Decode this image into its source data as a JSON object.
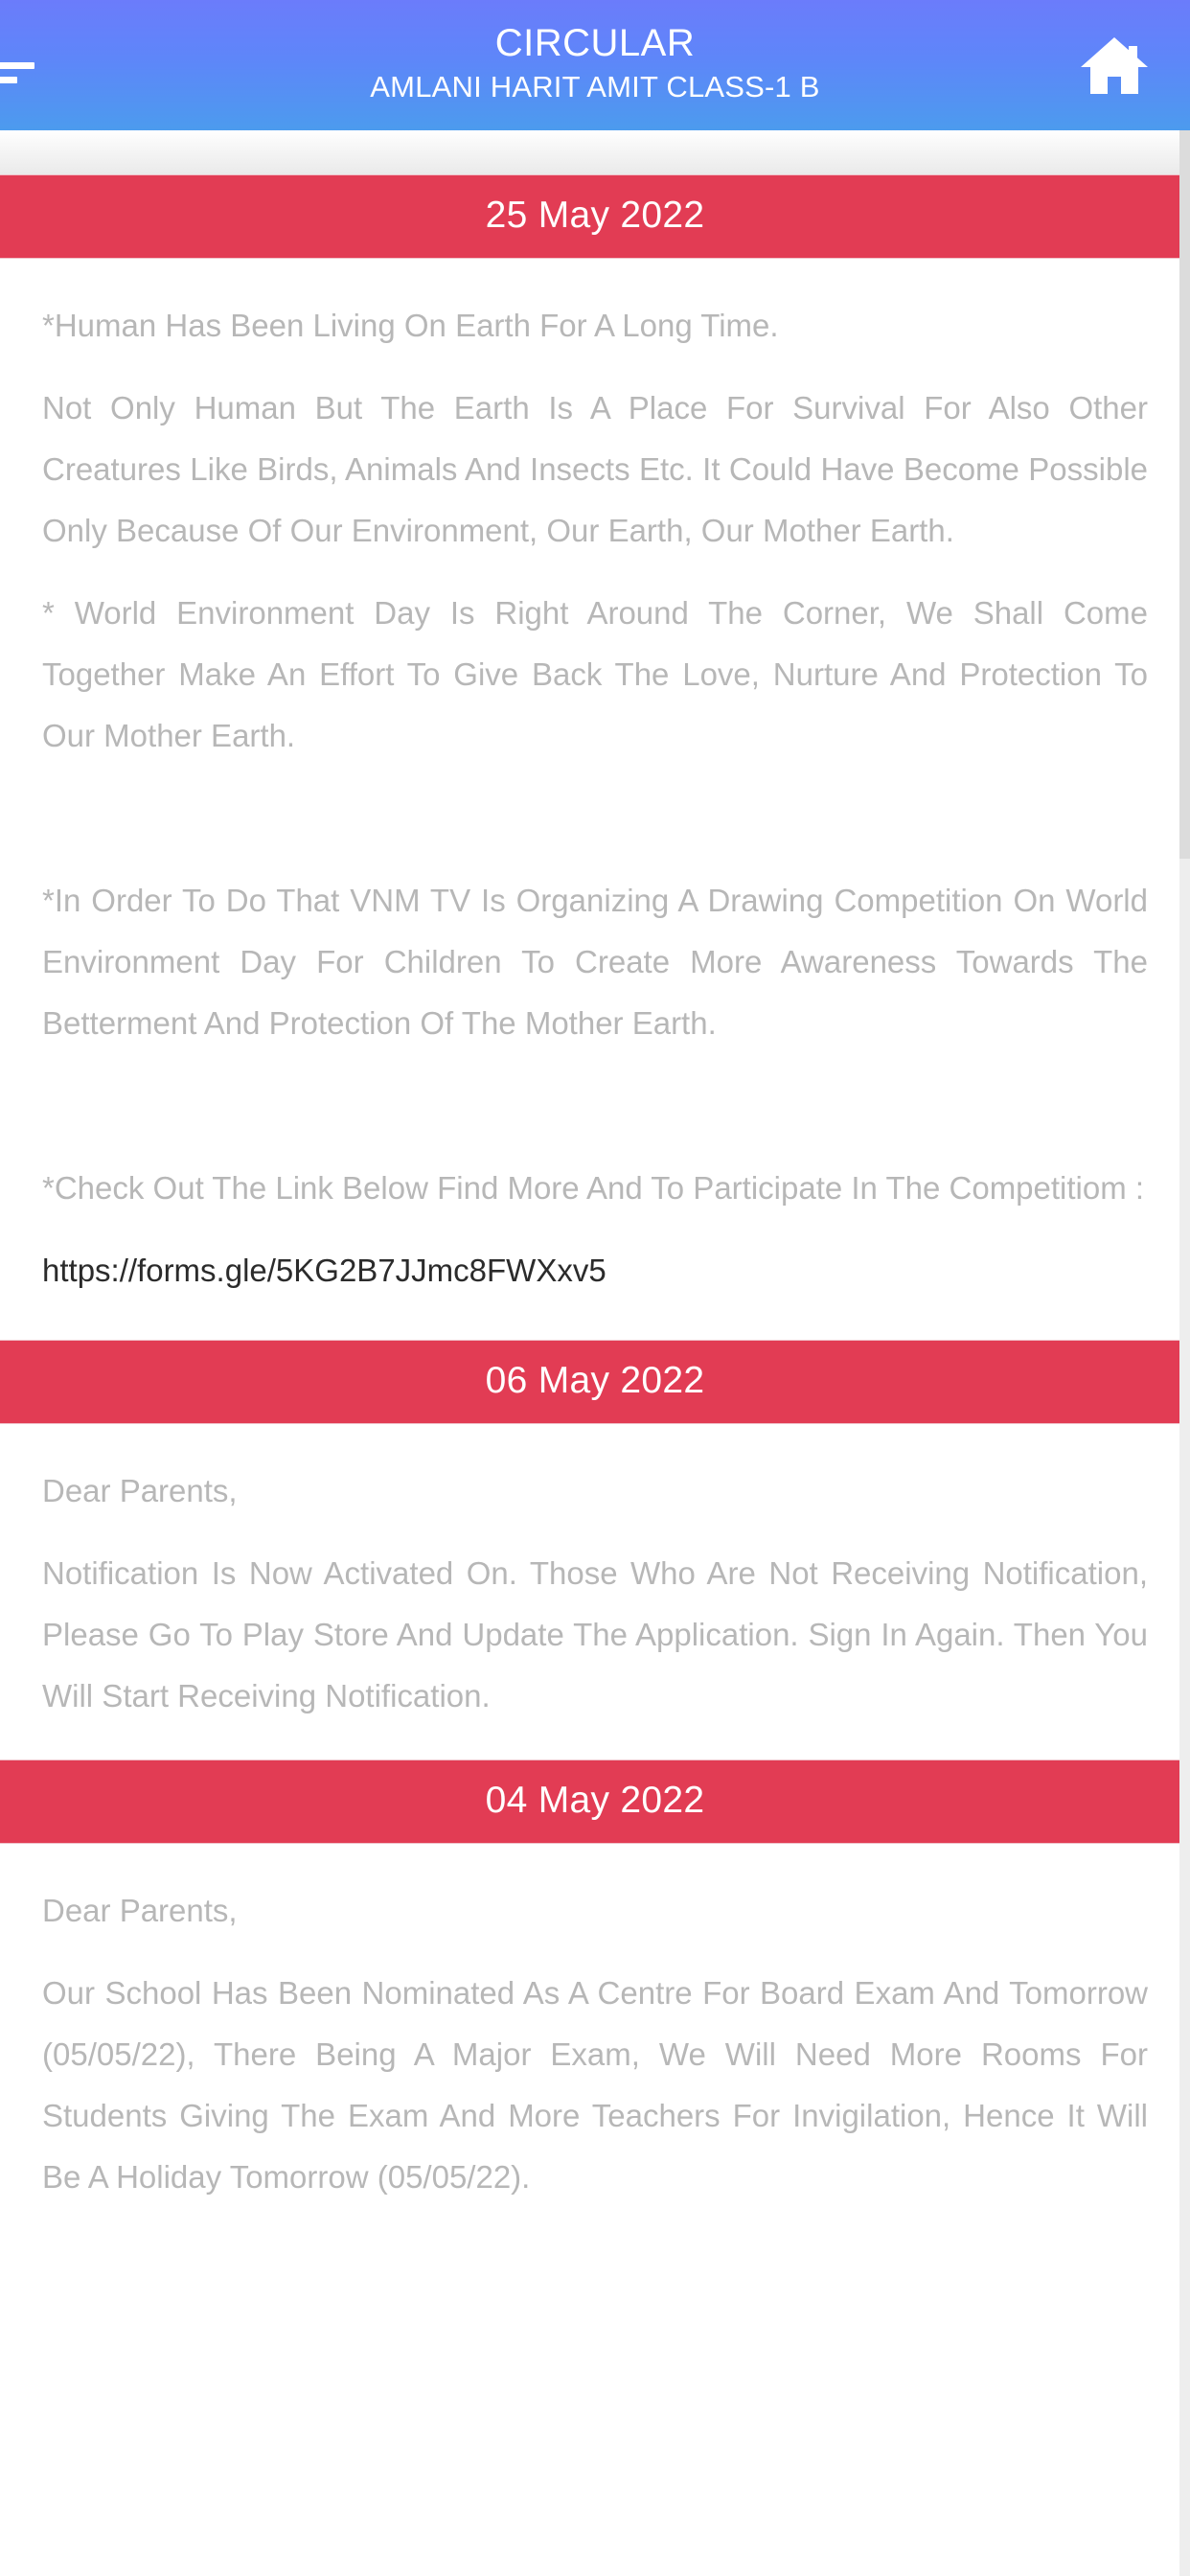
{
  "header": {
    "title": "CIRCULAR",
    "subtitle": "AMLANI HARIT AMIT CLASS-1 B",
    "menu_icon": "hamburger-menu-icon",
    "home_icon": "home-icon",
    "gradient_start": "#6B7CFB",
    "gradient_end": "#4C9BEE"
  },
  "theme": {
    "date_bar_color": "#E23C54",
    "body_text_color": "#B7B7B7",
    "link_text_color": "#2B2B2B",
    "page_background": "#FFFFFF"
  },
  "notices": [
    {
      "date": "25 May 2022",
      "paragraphs": [
        "*Human Has Been Living On Earth For A Long Time.",
        "Not Only Human But The Earth Is A Place For Survival For Also Other Creatures Like Birds, Animals And Insects Etc. It Could Have Become Possible Only Because Of Our Environment, Our Earth, Our Mother Earth.",
        "* World Environment Day Is Right Around The Corner, We Shall Come Together Make An Effort To Give Back The Love, Nurture And Protection To Our Mother Earth.",
        "",
        "*In Order To Do That VNM TV Is Organizing A Drawing Competition On World Environment Day For Children To Create More Awareness Towards The Betterment And Protection Of The Mother Earth.",
        "",
        "*Check Out The Link Below Find More And To Participate In The Competitiom :"
      ],
      "link": "https://forms.gle/5KG2B7JJmc8FWXxv5"
    },
    {
      "date": "06 May 2022",
      "paragraphs": [
        "Dear Parents,",
        "Notification Is Now Activated On.  Those Who Are Not Receiving Notification, Please Go To Play Store And Update The Application. Sign In Again. Then You Will Start Receiving Notification."
      ]
    },
    {
      "date": "04 May 2022",
      "paragraphs": [
        "Dear Parents,",
        "Our School Has Been Nominated As A Centre For Board Exam And Tomorrow (05/05/22), There Being A Major Exam, We Will Need More Rooms For Students Giving The Exam And More Teachers For Invigilation, Hence It Will Be A Holiday Tomorrow (05/05/22)."
      ]
    }
  ]
}
